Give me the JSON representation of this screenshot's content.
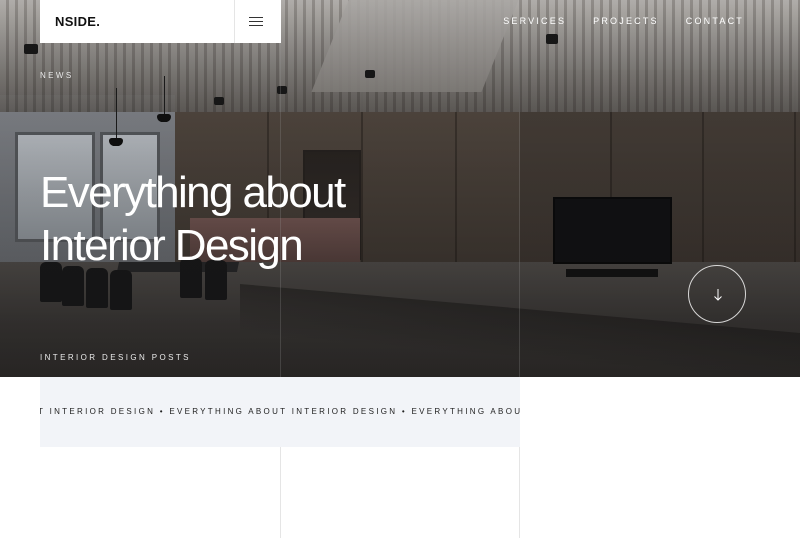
{
  "brand": {
    "logo": "NSIDE."
  },
  "header": {
    "menu_icon": "hamburger-menu-icon",
    "nav": [
      {
        "label": "SERVICES"
      },
      {
        "label": "PROJECTS"
      },
      {
        "label": "CONTACT"
      }
    ]
  },
  "hero": {
    "eyebrow": "NEWS",
    "title_line1": "Everything about",
    "title_line2": "Interior Design",
    "subtitle": "INTERIOR DESIGN POSTS",
    "scroll_icon": "arrow-down-icon"
  },
  "marquee": {
    "text": "T INTERIOR DESIGN • EVERYTHING ABOUT INTERIOR DESIGN • EVERYTHING ABOUT INTERIOR DESIGN"
  },
  "colors": {
    "accent_bg": "#f2f4f8",
    "text_dark": "#111111",
    "text_light": "#ffffff"
  }
}
